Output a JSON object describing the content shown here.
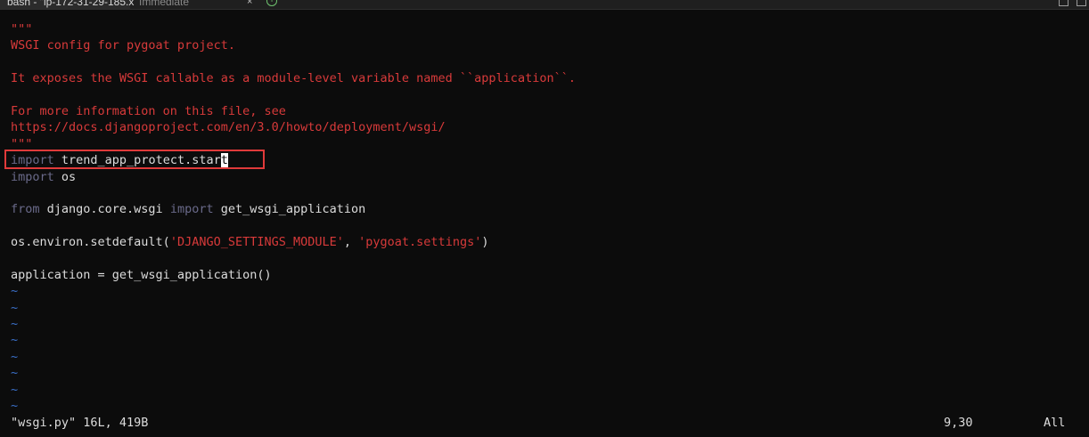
{
  "tabs": [
    {
      "label": "bash - \"ip-172-31-29-185.x",
      "active": true
    },
    {
      "label": "Immediate",
      "active": false
    }
  ],
  "code": {
    "doc_open": "\"\"\"",
    "doc_line1": "WSGI config for pygoat project.",
    "doc_line2": "It exposes the WSGI callable as a module-level variable named ``application``.",
    "doc_line3": "For more information on this file, see",
    "doc_line4": "https://docs.djangoproject.com/en/3.0/howto/deployment/wsgi/",
    "doc_close": "\"\"\"",
    "import_kw": "import",
    "import1_module_before_cursor": " trend_app_protect.star",
    "import1_cursor_char": "t",
    "import2_module": " os",
    "from_kw": "from",
    "from_module": " django.core.wsgi ",
    "from_import_kw": "import",
    "from_name": " get_wsgi_application",
    "setdefault_call": "os.environ.setdefault(",
    "setdefault_arg1": "'DJANGO_SETTINGS_MODULE'",
    "setdefault_sep": ", ",
    "setdefault_arg2": "'pygoat.settings'",
    "setdefault_end": ")",
    "application_line": "application = get_wsgi_application()",
    "tilde": "~"
  },
  "status": {
    "file_info": "\"wsgi.py\" 16L, 419B",
    "position": "9,30",
    "scroll": "All"
  },
  "colors": {
    "background": "#0c0c0c",
    "docstring": "#d83a3a",
    "keyword": "#6a6a8a",
    "tilde": "#3a6fc8",
    "highlight_box": "#e03a3a"
  }
}
